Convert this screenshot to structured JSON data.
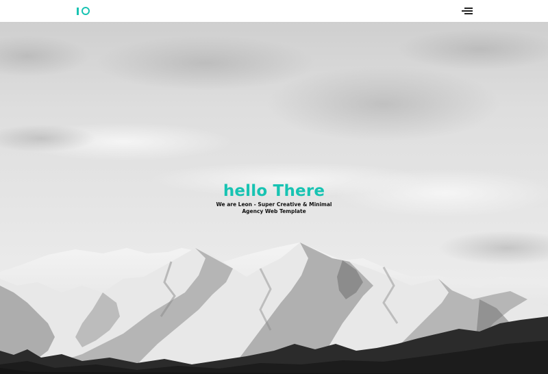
{
  "brand": {
    "logo_icon": "io-logo-icon",
    "accent_color": "#17c3b2"
  },
  "nav": {
    "menu_icon": "hamburger-menu-icon"
  },
  "hero": {
    "title": "hello There",
    "subtitle": "We are Leon - Super Creative & Minimal Agency Web Template",
    "background": "grayscale mountain landscape with cloudy sky"
  }
}
